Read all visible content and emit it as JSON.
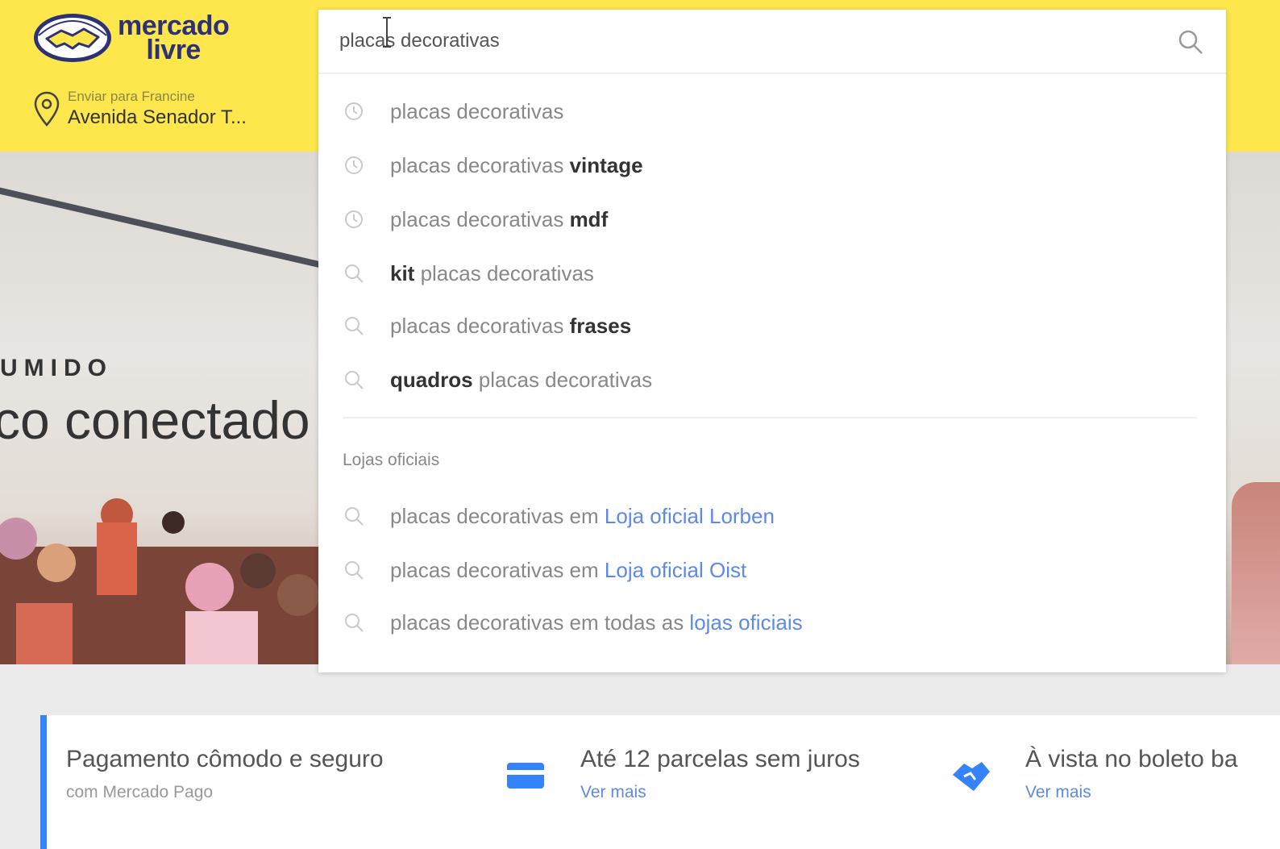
{
  "header": {
    "logo_line1": "mercado",
    "logo_line2": "livre",
    "location_label": "Enviar para Francine",
    "location_address": "Avenida Senador T..."
  },
  "hero": {
    "eyebrow": "UMIDO",
    "title": "co conectado"
  },
  "search": {
    "value": "placas decorativas",
    "suggestions": [
      {
        "pre": "placas decorativas",
        "bold": "",
        "post": ""
      },
      {
        "pre": "placas decorativas ",
        "bold": "vintage",
        "post": ""
      },
      {
        "pre": "placas decorativas ",
        "bold": "mdf",
        "post": ""
      },
      {
        "pre": "",
        "bold": "kit",
        "post": " placas decorativas"
      },
      {
        "pre": "placas decorativas ",
        "bold": "frases",
        "post": ""
      },
      {
        "pre": "",
        "bold": "quadros",
        "post": " placas decorativas"
      }
    ],
    "stores_title": "Lojas oficiais",
    "store_suggestions": [
      {
        "pre": "placas decorativas em ",
        "link": "Loja oficial Lorben"
      },
      {
        "pre": "placas decorativas em ",
        "link": "Loja oficial Oist"
      },
      {
        "pre": "placas decorativas em todas as ",
        "link": "lojas oficiais"
      }
    ]
  },
  "benefits": {
    "items": [
      {
        "title": "Pagamento cômodo e seguro",
        "sub": "com Mercado Pago"
      },
      {
        "title": "Até 12 parcelas sem juros",
        "link": "Ver mais"
      },
      {
        "title": "À vista no boleto ba",
        "link": "Ver mais"
      }
    ]
  },
  "colors": {
    "header_yellow": "#fde74c",
    "brand_navy": "#2d3277",
    "link_blue": "#5c8ae6",
    "accent_blue": "#3483fa"
  },
  "icons": [
    "handshake-logo-icon",
    "location-pin-icon",
    "search-icon",
    "clock-icon",
    "credit-card-icon",
    "handshake-icon"
  ]
}
